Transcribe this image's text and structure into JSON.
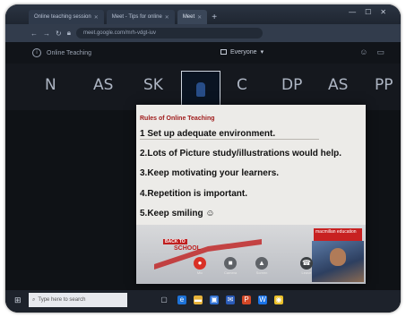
{
  "browser": {
    "tabs": [
      {
        "label": "Online teaching session",
        "active": false
      },
      {
        "label": "Meet - Tips for online",
        "active": false
      },
      {
        "label": "Meet",
        "active": true
      }
    ],
    "new_tab": "+",
    "url": "meet.google.com/mrh-vdgt-iuv"
  },
  "meet": {
    "meeting_title": "Online Teaching",
    "view_label": "Everyone",
    "participants": [
      "N",
      "AS",
      "SK",
      "C",
      "DP",
      "AS",
      "PP"
    ]
  },
  "slide": {
    "heading": "Rules of Online Teaching",
    "items": [
      "1 Set up adequate environment.",
      "2.Lots of Picture study/illustrations would help.",
      "3.Keep motivating your learners.",
      "4.Repetition is important.",
      "5.Keep smiling ☺"
    ],
    "school_label": "SCHOOL",
    "school_small": "BACK TO",
    "publisher_logo": "macmillan education"
  },
  "controls": [
    {
      "label": "Mic",
      "icon": "microphone-icon",
      "color": "#d93025",
      "glyph": "●"
    },
    {
      "label": "Camera",
      "icon": "camera-icon",
      "color": "#5f6368",
      "glyph": "■"
    },
    {
      "label": "Screen",
      "icon": "present-icon",
      "color": "#5f6368",
      "glyph": "▲"
    },
    {
      "label": "Leave",
      "icon": "hangup-icon",
      "color": "#3c4043",
      "glyph": "☎"
    }
  ],
  "taskbar": {
    "search_placeholder": "Type here to search"
  }
}
